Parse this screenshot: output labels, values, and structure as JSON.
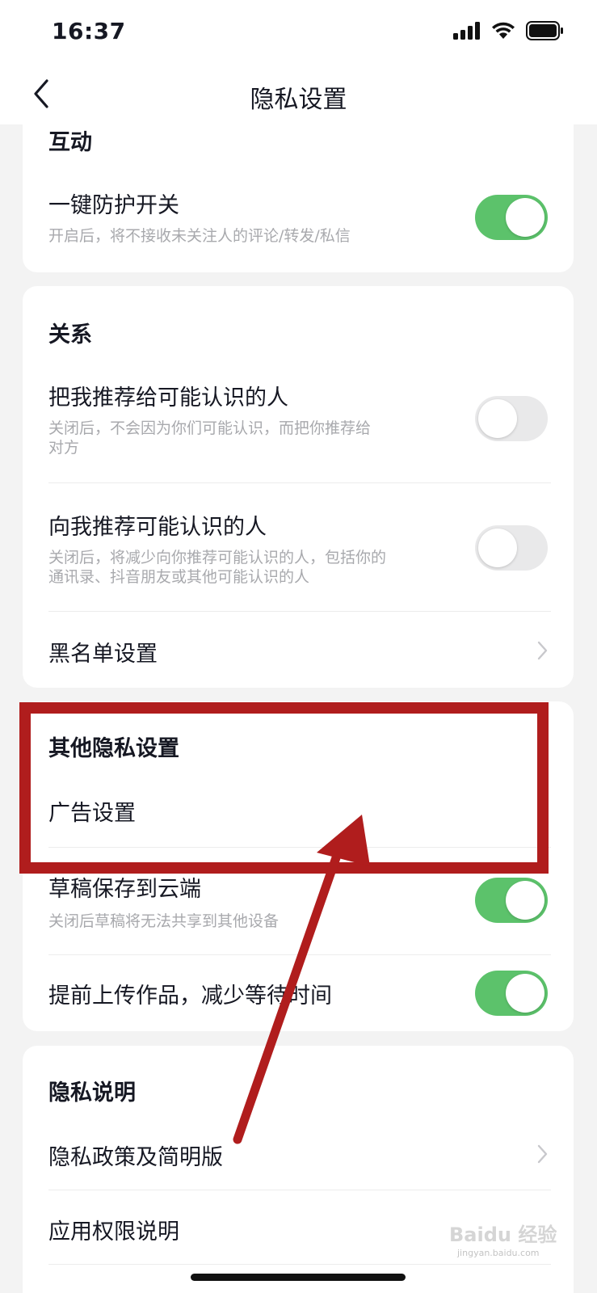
{
  "status_bar": {
    "time": "16:37",
    "icons": [
      "signal-icon",
      "wifi-icon",
      "battery-icon"
    ]
  },
  "header": {
    "back_icon": "chevron-left-icon",
    "title": "隐私设置"
  },
  "sections": {
    "interaction": {
      "title": "互动",
      "one_key_protection": {
        "label": "一键防护开关",
        "description": "开启后，将不接收未关注人的评论/转发/私信",
        "enabled": true
      }
    },
    "relationship": {
      "title": "关系",
      "recommend_me": {
        "label": "把我推荐给可能认识的人",
        "description_line1": "关闭后，不会因为你们可能认识，而把你推荐给",
        "description_line2": "对方",
        "enabled": false
      },
      "recommend_to_me": {
        "label": "向我推荐可能认识的人",
        "description_line1": "关闭后，将减少向你推荐可能认识的人，包括你的",
        "description_line2": "通讯录、抖音朋友或其他可能认识的人",
        "enabled": false
      },
      "blacklist": {
        "label": "黑名单设置"
      }
    },
    "other_privacy": {
      "title": "其他隐私设置",
      "ad_settings": {
        "label": "广告设置"
      },
      "draft_cloud": {
        "label": "草稿保存到云端",
        "description": "关闭后草稿将无法共享到其他设备",
        "enabled": true
      },
      "pre_upload": {
        "label": "提前上传作品，减少等待时间",
        "enabled": true
      }
    },
    "privacy_notes": {
      "title": "隐私说明",
      "policy": {
        "label": "隐私政策及简明版"
      },
      "permissions": {
        "label": "应用权限说明"
      }
    }
  },
  "colors": {
    "switch_on": "#5cc26b",
    "switch_off": "#e9e9ea",
    "annotation": "#b01d1d",
    "background": "#f3f3f3"
  },
  "watermark": {
    "brand": "Baidu 经验",
    "url": "jingyan.baidu.com"
  }
}
